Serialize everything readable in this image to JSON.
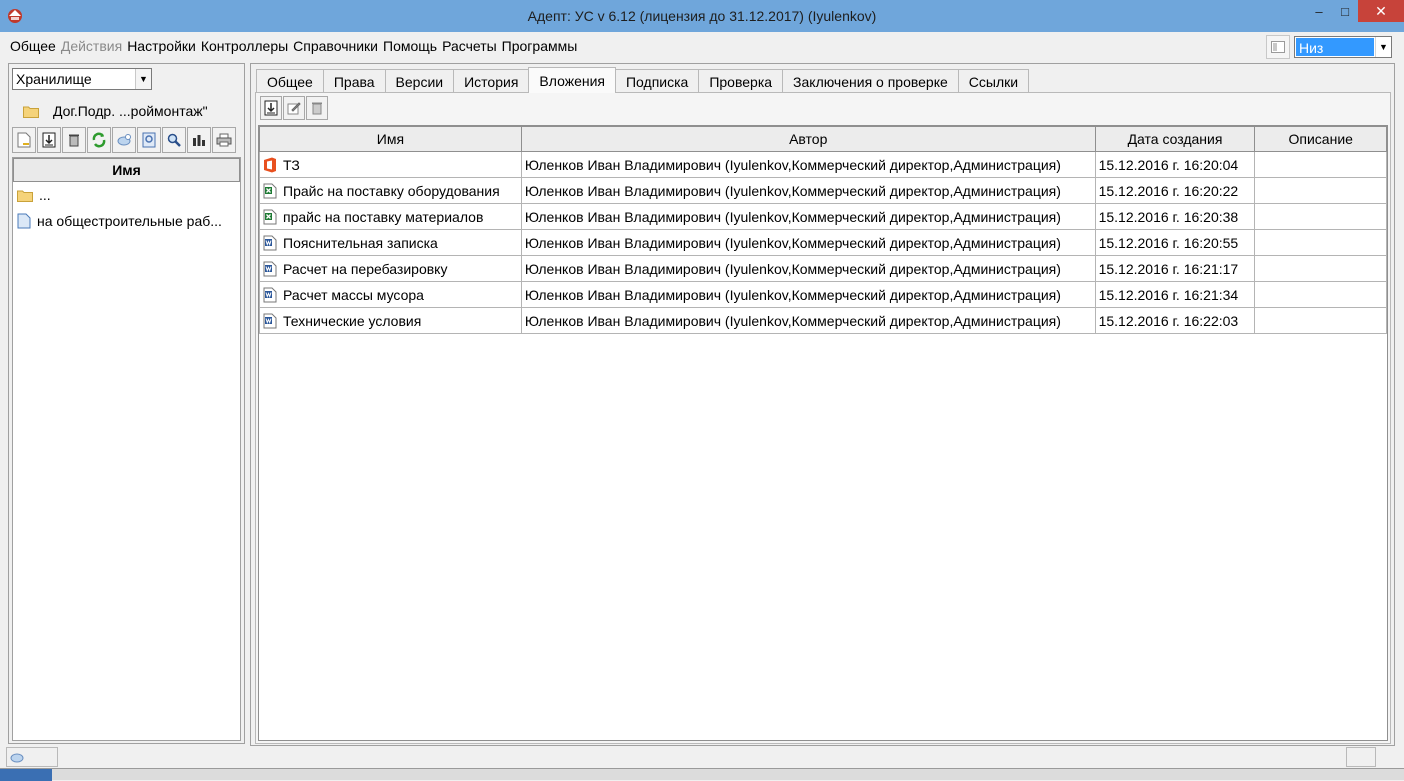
{
  "window": {
    "title": "Адепт: УС  v 6.12 (лицензия до 31.12.2017) (Iyulenkov)",
    "minimize": "–",
    "maximize": "□",
    "close": "✕"
  },
  "menu": [
    {
      "label": "Общее",
      "enabled": true
    },
    {
      "label": "Действия",
      "enabled": false
    },
    {
      "label": "Настройки",
      "enabled": true
    },
    {
      "label": "Контроллеры",
      "enabled": true
    },
    {
      "label": "Справочники",
      "enabled": true
    },
    {
      "label": "Помощь",
      "enabled": true
    },
    {
      "label": "Расчеты",
      "enabled": true
    },
    {
      "label": "Программы",
      "enabled": true
    }
  ],
  "position_select": {
    "value": "Низ"
  },
  "left": {
    "storage_select": "Хранилище",
    "folder_path": "Дог.Подр. ...роймонтаж\"",
    "toolbar": [
      "new-doc-icon",
      "download-icon",
      "trash-icon",
      "refresh-icon",
      "link-icon",
      "preview-icon",
      "search-icon",
      "chart-icon",
      "print-icon"
    ],
    "tree_header": "Имя",
    "tree": [
      {
        "label": "...",
        "icon": "folder-icon"
      },
      {
        "label": "на общестроительные раб...",
        "icon": "document-icon"
      }
    ]
  },
  "tabs": [
    {
      "label": "Общее",
      "active": false
    },
    {
      "label": "Права",
      "active": false
    },
    {
      "label": "Версии",
      "active": false
    },
    {
      "label": "История",
      "active": false
    },
    {
      "label": "Вложения",
      "active": true
    },
    {
      "label": "Подписка",
      "active": false
    },
    {
      "label": "Проверка",
      "active": false
    },
    {
      "label": "Заключения о проверке",
      "active": false
    },
    {
      "label": "Ссылки",
      "active": false
    }
  ],
  "attachments": {
    "toolbar": [
      "download-icon",
      "edit-icon",
      "trash-icon"
    ],
    "columns": [
      "Имя",
      "Автор",
      "Дата создания",
      "Описание"
    ],
    "rows": [
      {
        "icon": "office-icon",
        "name": "ТЗ",
        "author": "Юленков Иван Владимирович (Iyulenkov,Коммерческий директор,Администрация)",
        "date": "15.12.2016 г. 16:20:04",
        "description": ""
      },
      {
        "icon": "excel-icon",
        "name": "Прайс на поставку оборудования",
        "author": "Юленков Иван Владимирович (Iyulenkov,Коммерческий директор,Администрация)",
        "date": "15.12.2016 г. 16:20:22",
        "description": ""
      },
      {
        "icon": "excel-icon",
        "name": "прайс на поставку материалов",
        "author": "Юленков Иван Владимирович (Iyulenkov,Коммерческий директор,Администрация)",
        "date": "15.12.2016 г. 16:20:38",
        "description": ""
      },
      {
        "icon": "word-icon",
        "name": "Пояснительная записка",
        "author": "Юленков Иван Владимирович (Iyulenkov,Коммерческий директор,Администрация)",
        "date": "15.12.2016 г. 16:20:55",
        "description": ""
      },
      {
        "icon": "word-icon",
        "name": "Расчет на перебазировку",
        "author": "Юленков Иван Владимирович (Iyulenkov,Коммерческий директор,Администрация)",
        "date": "15.12.2016 г. 16:21:17",
        "description": ""
      },
      {
        "icon": "word-icon",
        "name": "Расчет массы мусора",
        "author": "Юленков Иван Владимирович (Iyulenkov,Коммерческий директор,Администрация)",
        "date": "15.12.2016 г. 16:21:34",
        "description": ""
      },
      {
        "icon": "word-icon",
        "name": "Технические условия",
        "author": "Юленков Иван Владимирович (Iyulenkov,Коммерческий директор,Администрация)",
        "date": "15.12.2016 г. 16:22:03",
        "description": ""
      }
    ]
  }
}
